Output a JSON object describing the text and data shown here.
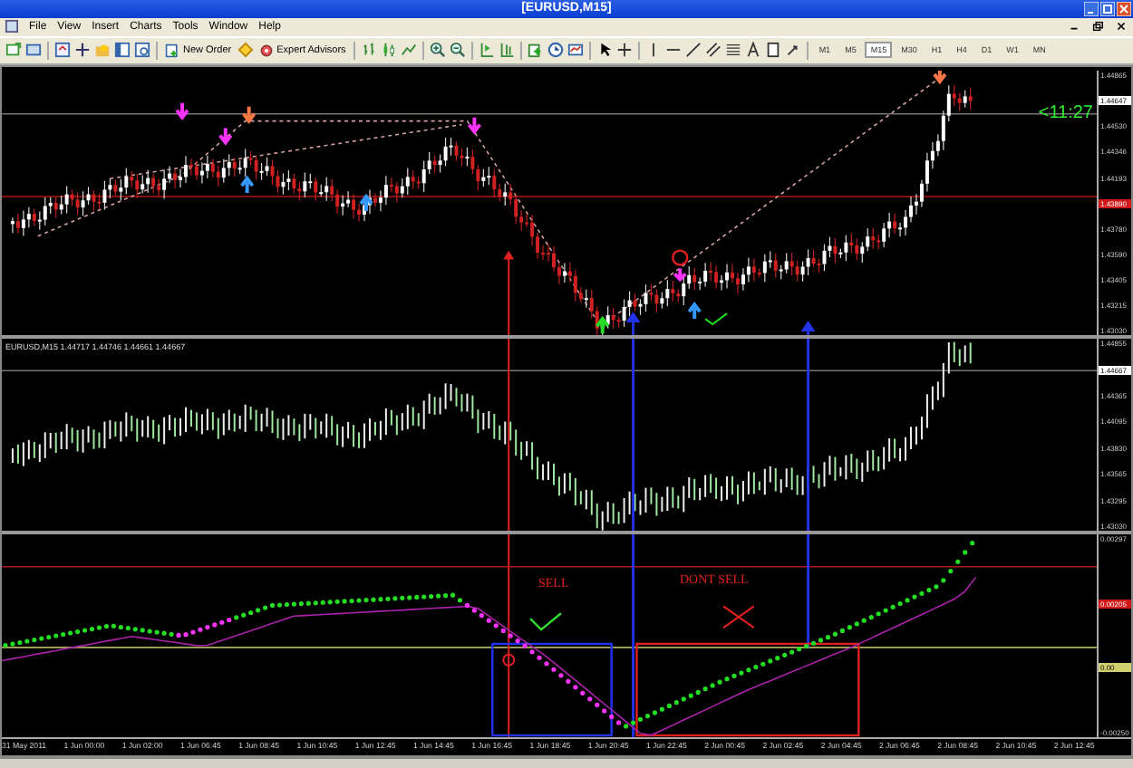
{
  "window": {
    "title": "[EURUSD,M15]"
  },
  "menu": [
    "File",
    "View",
    "Insert",
    "Charts",
    "Tools",
    "Window",
    "Help"
  ],
  "toolbar": {
    "new_order": "New Order",
    "expert_advisors": "Expert Advisors",
    "timeframes": [
      {
        "label": "M1",
        "selected": false
      },
      {
        "label": "M5",
        "selected": false
      },
      {
        "label": "M15",
        "selected": true
      },
      {
        "label": "M30",
        "selected": false
      },
      {
        "label": "H1",
        "selected": false
      },
      {
        "label": "H4",
        "selected": false
      },
      {
        "label": "D1",
        "selected": false
      },
      {
        "label": "W1",
        "selected": false
      },
      {
        "label": "MN",
        "selected": false
      }
    ]
  },
  "main_chart": {
    "countdown": "<11:27",
    "price_axis": [
      {
        "label": "1.44865",
        "kind": "plain"
      },
      {
        "label": "1.44647",
        "kind": "current"
      },
      {
        "label": "1.44530",
        "kind": "plain"
      },
      {
        "label": "1.44346",
        "kind": "plain"
      },
      {
        "label": "1.44193",
        "kind": "plain"
      },
      {
        "label": "1.43890",
        "kind": "level"
      },
      {
        "label": "1.43780",
        "kind": "plain"
      },
      {
        "label": "1.43590",
        "kind": "plain"
      },
      {
        "label": "1.43405",
        "kind": "plain"
      },
      {
        "label": "1.43215",
        "kind": "plain"
      },
      {
        "label": "1.43030",
        "kind": "plain"
      }
    ]
  },
  "sub_chart": {
    "legend": "EURUSD,M15  1.44717 1.44746 1.44661 1.44667",
    "price_axis": [
      {
        "label": "1.44855",
        "kind": "plain"
      },
      {
        "label": "1.44667",
        "kind": "current"
      },
      {
        "label": "1.44365",
        "kind": "plain"
      },
      {
        "label": "1.44095",
        "kind": "plain"
      },
      {
        "label": "1.43830",
        "kind": "plain"
      },
      {
        "label": "1.43565",
        "kind": "plain"
      },
      {
        "label": "1.43295",
        "kind": "plain"
      },
      {
        "label": "1.43030",
        "kind": "plain"
      }
    ]
  },
  "indicator": {
    "annotations": [
      {
        "text": "SELL"
      },
      {
        "text": "DONT SELL"
      }
    ],
    "price_axis": [
      {
        "label": "0.00297",
        "kind": "plain"
      },
      {
        "label": "0.00205",
        "kind": "level"
      },
      {
        "label": "0.00",
        "kind": "zero"
      },
      {
        "label": "-0.00250",
        "kind": "plain"
      }
    ]
  },
  "time_axis": [
    "31 May 2011",
    "1 Jun 00:00",
    "1 Jun 02:00",
    "1 Jun 06:45",
    "1 Jun 08:45",
    "1 Jun 10:45",
    "1 Jun 12:45",
    "1 Jun 14:45",
    "1 Jun 16:45",
    "1 Jun 18:45",
    "1 Jun 20:45",
    "1 Jun 22:45",
    "2 Jun 00:45",
    "2 Jun 02:45",
    "2 Jun 04:45",
    "2 Jun 06:45",
    "2 Jun 08:45",
    "2 Jun 10:45",
    "2 Jun 12:45"
  ]
}
